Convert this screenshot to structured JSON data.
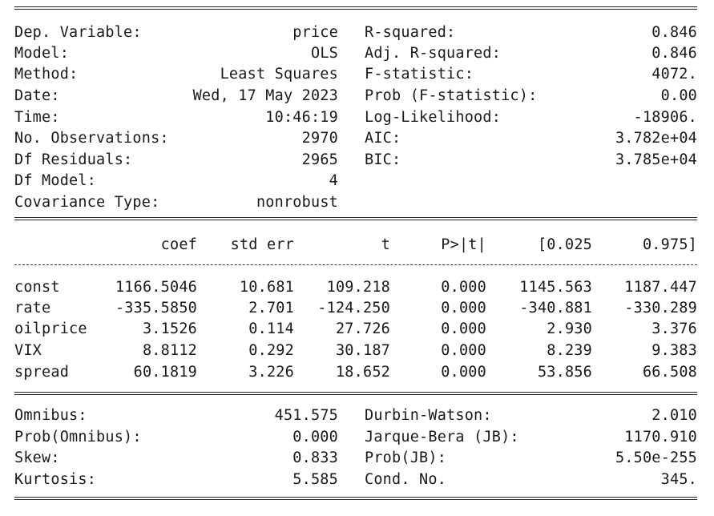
{
  "header_left": [
    {
      "label": "Dep. Variable:",
      "value": "price"
    },
    {
      "label": "Model:",
      "value": "OLS"
    },
    {
      "label": "Method:",
      "value": "Least Squares"
    },
    {
      "label": "Date:",
      "value": "Wed, 17 May 2023"
    },
    {
      "label": "Time:",
      "value": "10:46:19"
    },
    {
      "label": "No. Observations:",
      "value": "2970"
    },
    {
      "label": "Df Residuals:",
      "value": "2965"
    },
    {
      "label": "Df Model:",
      "value": "4"
    },
    {
      "label": "Covariance Type:",
      "value": "nonrobust"
    }
  ],
  "header_right": [
    {
      "label": "R-squared:",
      "value": "0.846"
    },
    {
      "label": "Adj. R-squared:",
      "value": "0.846"
    },
    {
      "label": "F-statistic:",
      "value": "4072."
    },
    {
      "label": "Prob (F-statistic):",
      "value": "0.00"
    },
    {
      "label": "Log-Likelihood:",
      "value": "-18906."
    },
    {
      "label": "AIC:",
      "value": "3.782e+04"
    },
    {
      "label": "BIC:",
      "value": "3.785e+04"
    }
  ],
  "coef_table": {
    "columns": [
      "coef",
      "std err",
      "t",
      "P>|t|",
      "[0.025",
      "0.975]"
    ],
    "rows": [
      {
        "name": "const",
        "values": [
          "1166.5046",
          "10.681",
          "109.218",
          "0.000",
          "1145.563",
          "1187.447"
        ]
      },
      {
        "name": "rate",
        "values": [
          "-335.5850",
          "2.701",
          "-124.250",
          "0.000",
          "-340.881",
          "-330.289"
        ]
      },
      {
        "name": "oilprice",
        "values": [
          "3.1526",
          "0.114",
          "27.726",
          "0.000",
          "2.930",
          "3.376"
        ]
      },
      {
        "name": "VIX",
        "values": [
          "8.8112",
          "0.292",
          "30.187",
          "0.000",
          "8.239",
          "9.383"
        ]
      },
      {
        "name": "spread",
        "values": [
          "60.1819",
          "3.226",
          "18.652",
          "0.000",
          "53.856",
          "66.508"
        ]
      }
    ]
  },
  "diag_left": [
    {
      "label": "Omnibus:",
      "value": "451.575"
    },
    {
      "label": "Prob(Omnibus):",
      "value": "0.000"
    },
    {
      "label": "Skew:",
      "value": "0.833"
    },
    {
      "label": "Kurtosis:",
      "value": "5.585"
    }
  ],
  "diag_right": [
    {
      "label": "Durbin-Watson:",
      "value": "2.010"
    },
    {
      "label": "Jarque-Bera (JB):",
      "value": "1170.910"
    },
    {
      "label": "Prob(JB):",
      "value": "5.50e-255"
    },
    {
      "label": "Cond. No.",
      "value": "345."
    }
  ]
}
